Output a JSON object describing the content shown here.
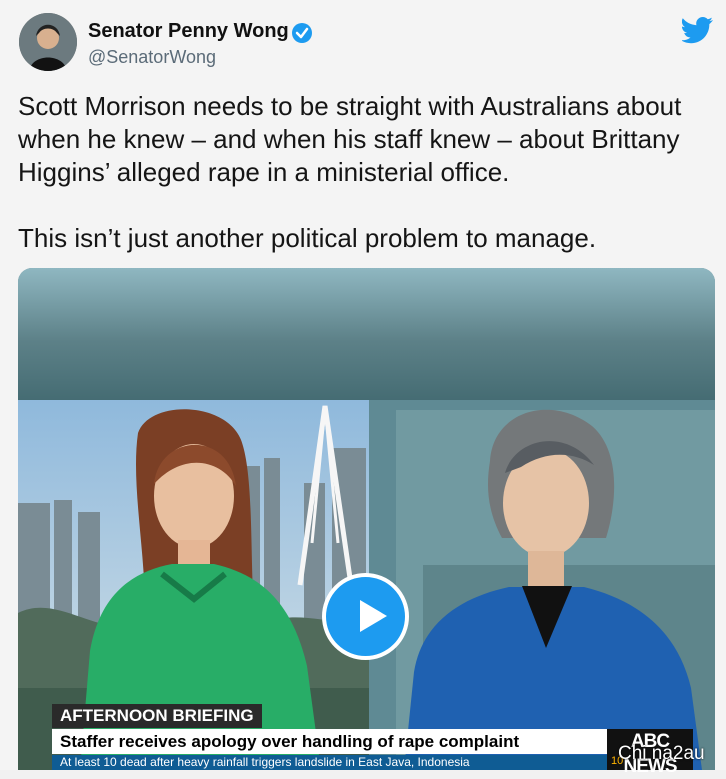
{
  "author": {
    "name": "Senator Penny Wong",
    "handle": "@SenatorWong"
  },
  "tweet": {
    "paragraph_1": "Scott Morrison needs to be straight with Australians about when he knew – and when his staff knew – about Brittany Higgins’ alleged rape in a ministerial office.",
    "paragraph_2": "This isn’t just another political problem to manage."
  },
  "video": {
    "program": "AFTERNOON BRIEFING",
    "headline": "Staffer receives apology over handling of rape complaint",
    "ticker": "At least 10 dead after heavy rainfall triggers landslide in East Java, Indonesia",
    "network": "ABC NEWS",
    "clock": "10",
    "watermark": "Chi na2au"
  },
  "icons": {
    "verified": "verified-badge-icon",
    "twitter": "twitter-bird-icon",
    "play": "play-icon"
  },
  "colors": {
    "twitter_blue": "#1d9bf0",
    "ticker_blue": "#0f5c94"
  }
}
